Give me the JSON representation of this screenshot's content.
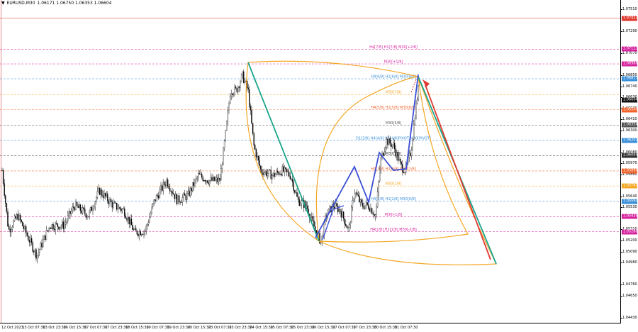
{
  "title": {
    "symbol": "EURUSD,M30",
    "ohlc": "1.06171 1.06750 1.06353 1.06604"
  },
  "price_axis": {
    "ticks": [
      "1.07510",
      "1.07290",
      "1.07070",
      "1.06850",
      "1.06740",
      "1.06630",
      "1.06520",
      "1.06410",
      "1.06300",
      "1.06080",
      "1.05970",
      "1.05860",
      "1.05640",
      "1.05530",
      "1.05310",
      "1.05200",
      "1.05090",
      "1.04980",
      "1.04760",
      "1.04650",
      "1.04430"
    ],
    "badges": [
      {
        "text": "1.07422",
        "color": "#e0392f"
      },
      {
        "text": "1.07113",
        "color": "#d6249f"
      },
      {
        "text": "1.06966",
        "color": "#d6249f"
      },
      {
        "text": "1.06817",
        "color": "#3a8fd9"
      },
      {
        "text": "1.06604",
        "color": "#111111"
      },
      {
        "text": "1.06508",
        "color": "#f0622a"
      },
      {
        "text": "1.06354",
        "color": "#555555"
      },
      {
        "text": "1.06201",
        "color": "#3a8fd9"
      },
      {
        "text": "1.06049",
        "color": "#333333"
      },
      {
        "text": "1.05896",
        "color": "#f0622a"
      },
      {
        "text": "1.05745",
        "color": "#f5a623"
      },
      {
        "text": "1.05593",
        "color": "#3a8fd9"
      },
      {
        "text": "1.05439",
        "color": "#d6249f"
      },
      {
        "text": "1.05288",
        "color": "#d6249f"
      }
    ]
  },
  "time_axis": {
    "ticks": [
      "12 Oct 2023",
      "13 Oct 07:30",
      "13 Oct 23:30",
      "16 Oct 15:30",
      "17 Oct 07:30",
      "17 Oct 23:30",
      "18 Oct 15:30",
      "19 Oct 07:30",
      "19 Oct 23:30",
      "20 Oct 15:30",
      "23 Oct 07:30",
      "23 Oct 23:30",
      "24 Oct 15:30",
      "25 Oct 07:30",
      "25 Oct 23:30",
      "26 Oct 15:30",
      "27 Oct 07:30",
      "27 Oct 23:30",
      "30 Oct 15:30",
      "31 Oct 07:30"
    ]
  },
  "levels": [
    {
      "label": "",
      "price": 1.07422,
      "color": "#e0392f",
      "style": "solid"
    },
    {
      "label": "H4[7/8] H1[7/8] M30[+2/8]",
      "price": 1.07113,
      "color": "#d6249f",
      "style": "dash"
    },
    {
      "label": "M30[+1/8]",
      "price": 1.06966,
      "color": "#d6249f",
      "style": "dash"
    },
    {
      "label": "H4[6/8] H1[6/8] M30[8/8]",
      "price": 1.06817,
      "color": "#3a8fd9",
      "style": "dash"
    },
    {
      "label": "M30[7/8]",
      "price": 1.0666,
      "color": "#f5a623",
      "style": "dash"
    },
    {
      "label": "H4[5/8] H1[5/8] M30[6/8]",
      "price": 1.06508,
      "color": "#f0622a",
      "style": "dash"
    },
    {
      "label": "M30[5/8]",
      "price": 1.06354,
      "color": "#555555",
      "style": "dash"
    },
    {
      "label": "D1[3/8] H4[4/8] H1[4/8]PIVOT M30[PIVOT]",
      "price": 1.06201,
      "color": "#3a8fd9",
      "style": "dash"
    },
    {
      "label": "M30[3/8]",
      "price": 1.06049,
      "color": "#333333",
      "style": "dash"
    },
    {
      "label": "H4[3/8] H1[3/8] M30[2/8]",
      "price": 1.05896,
      "color": "#f0622a",
      "style": "dash"
    },
    {
      "label": "M30[1/8]",
      "price": 1.05745,
      "color": "#f5a623",
      "style": "dash"
    },
    {
      "label": "H4[2/8] H1[2/8] M30[0/8]",
      "price": 1.05593,
      "color": "#3a8fd9",
      "style": "dash"
    },
    {
      "label": "M30[-1/8]",
      "price": 1.05439,
      "color": "#d6249f",
      "style": "dash"
    },
    {
      "label": "H4[1/8] H1[1/8] M30[-2/8]",
      "price": 1.05288,
      "color": "#d6249f",
      "style": "dash"
    }
  ],
  "colors": {
    "candle": "#000000",
    "arc": "#f5a623",
    "impulse": "#3a4fd6",
    "projection_green": "#1aa58a",
    "projection_red": "#e0392f"
  }
}
